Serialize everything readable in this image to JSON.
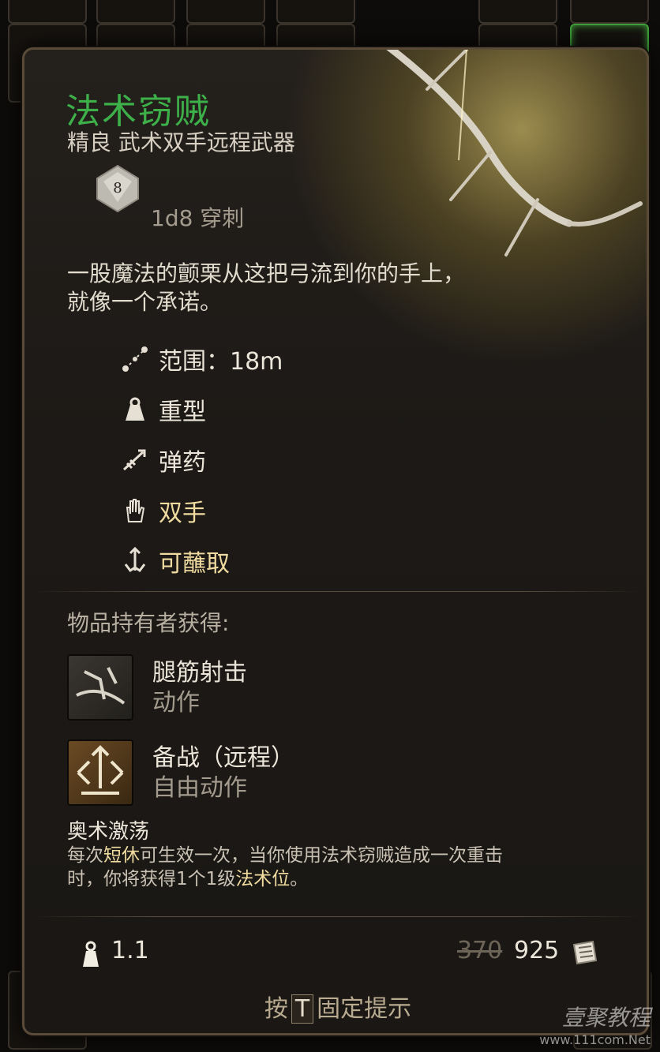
{
  "background_inventory": {
    "visible_counts": [
      "5",
      "4",
      "5"
    ]
  },
  "item": {
    "name": "法术窃贼",
    "subtitle": "精良 武术双手远程武器",
    "die_face": "8",
    "damage": "1d8 穿刺",
    "flavor_line1": "一股魔法的颤栗从这把弓流到你的手上，",
    "flavor_line2": "就像一个承诺。",
    "properties": [
      {
        "icon": "range-icon",
        "label": "范围：18m",
        "highlight": false
      },
      {
        "icon": "heavy-icon",
        "label": "重型",
        "highlight": false
      },
      {
        "icon": "ammunition-icon",
        "label": "弹药",
        "highlight": false
      },
      {
        "icon": "two-handed-icon",
        "label": "双手",
        "highlight": true
      },
      {
        "icon": "dippable-icon",
        "label": "可蘸取",
        "highlight": true
      }
    ],
    "grants_heading": "物品持有者获得:",
    "grants": [
      {
        "icon": "hamstring-shot-icon",
        "name": "腿筋射击",
        "type": "动作"
      },
      {
        "icon": "ranged-readiness-icon",
        "name": "备战（远程）",
        "type": "自由动作"
      }
    ],
    "passive": {
      "title": "奥术激荡",
      "p1": "每次",
      "k1": "短休",
      "p2": "可生效一次，当你使用法术窃贼造成一次重击",
      "p3": "时，你将获得1个1级",
      "k2": "法术位",
      "p4": "。"
    },
    "weight": "1.1",
    "old_price": "370",
    "price": "925"
  },
  "footer": {
    "pin_prefix": "按",
    "pin_key": "T",
    "pin_suffix": "固定提示"
  },
  "watermark": {
    "name": "壹聚教程",
    "url": "www.111com.Net"
  },
  "colors": {
    "item_name": "#3db04a",
    "keyword": "#f0dca0",
    "panel_border": "#5a4a38"
  }
}
